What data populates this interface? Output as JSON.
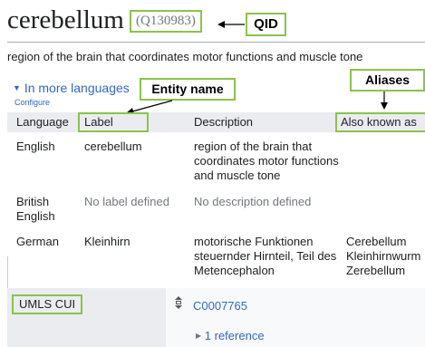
{
  "entity": {
    "title": "cerebellum",
    "qid": "(Q130983)",
    "description": "region of the brain that coordinates motor functions and muscle tone"
  },
  "callouts": {
    "qid": "QID",
    "entity_name": "Entity name",
    "aliases": "Aliases"
  },
  "languages_section": {
    "toggle_label": "In more languages",
    "configure_label": "Configure",
    "columns": [
      "Language",
      "Label",
      "Description",
      "Also known as"
    ],
    "rows": [
      {
        "language": "English",
        "label": "cerebellum",
        "description": "region of the brain that coordinates motor functions and muscle tone",
        "aliases": []
      },
      {
        "language": "British English",
        "label": "No label defined",
        "description": "No description defined",
        "aliases": []
      },
      {
        "language": "German",
        "label": "Kleinhirn",
        "description": "motorische Funktionen steuernder Hirnteil, Teil des Metencephalon",
        "aliases": [
          "Cerebellum",
          "Kleinhirnwurm",
          "Zerebellum"
        ]
      }
    ]
  },
  "statement": {
    "property": "UMLS CUI",
    "value": "C0007765",
    "references": "1 reference"
  },
  "colors": {
    "callout_border": "#8bc34a",
    "link": "#3366cc",
    "muted_text": "#72777d",
    "header_bg": "#eaecf0"
  }
}
